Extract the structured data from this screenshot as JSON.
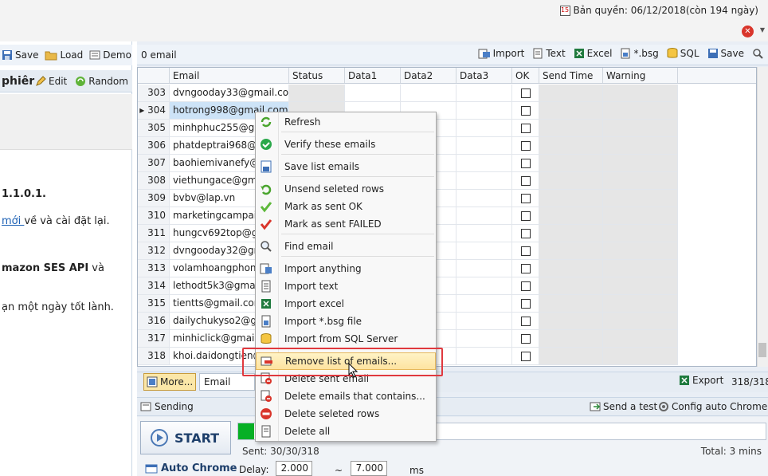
{
  "license": {
    "text": "Bản quyền: 06/12/2018(còn 194 ngày)",
    "cal_icon": "calendar-icon"
  },
  "left": {
    "toolbar": {
      "save": "Save",
      "load": "Load",
      "demo": "Demo"
    },
    "toolbar2": {
      "title": "phiêr",
      "edit": "Edit",
      "random": "Random"
    },
    "lines": {
      "version": "1.1.0.1.",
      "download_link": "mới ",
      "download_rest": "về và cài đặt lại.",
      "ses_bold": "mazon SES API",
      "ses_rest": " và",
      "greeting": "ạn một ngày tốt lành."
    }
  },
  "right": {
    "count_label": "0 email",
    "toolbar": {
      "import": "Import",
      "text": "Text",
      "excel": "Excel",
      "bsg": "*.bsg",
      "sql": "SQL",
      "save": "Save"
    },
    "columns": [
      "",
      "Email",
      "Status",
      "Data1",
      "Data2",
      "Data3",
      "OK",
      "Send Time",
      "Warning"
    ],
    "rows": [
      {
        "no": "303",
        "email": "dvngooday33@gmail.co"
      },
      {
        "no": "304",
        "email": "hotrong998@gmail.com"
      },
      {
        "no": "305",
        "email": "minhphuc255@gmail.c"
      },
      {
        "no": "306",
        "email": "phatdeptrai968@gmail"
      },
      {
        "no": "307",
        "email": "baohiemivanefy@gm"
      },
      {
        "no": "308",
        "email": "viethungace@gmail.c"
      },
      {
        "no": "309",
        "email": "bvbv@lap.vn"
      },
      {
        "no": "310",
        "email": "marketingcampaign"
      },
      {
        "no": "311",
        "email": "hungcv692top@gmail"
      },
      {
        "no": "312",
        "email": "dvngooday32@gmail."
      },
      {
        "no": "313",
        "email": "volamhoangphong@"
      },
      {
        "no": "314",
        "email": "lethodt5k3@gmail.co"
      },
      {
        "no": "315",
        "email": "tientts@gmail.com"
      },
      {
        "no": "316",
        "email": "dailychukyso2@gmai"
      },
      {
        "no": "317",
        "email": "minhiclick@gmail.co"
      },
      {
        "no": "318",
        "email": "khoi.daidongtien@g"
      }
    ],
    "bottom": {
      "more": "More...",
      "email_select": "Email",
      "export": "Export",
      "count": "318/318"
    },
    "send": {
      "label": "Sending",
      "send_test": "Send a test",
      "config_chrome": "Config auto Chrome",
      "start": "START",
      "progress": 1.0,
      "progress_color": "#06b025",
      "sent": "Sent: 30/30/318",
      "total": "Total: 3 mins",
      "auto_chrome": "Auto Chrome",
      "delay_label": "Delay:",
      "delay_min": "2.000",
      "tilde": "~",
      "delay_max": "7.000",
      "ms": "ms"
    }
  },
  "context_menu": {
    "items": [
      {
        "label": "Refresh",
        "icon": "refresh-icon"
      },
      {
        "label": "Verify these emails",
        "icon": "check-circle-icon"
      },
      {
        "label": "Save list emails",
        "icon": "save-list-icon"
      },
      {
        "label": "Unsend seleted rows",
        "icon": "undo-icon"
      },
      {
        "label": "Mark as sent OK",
        "icon": "green-check-icon"
      },
      {
        "label": "Mark as sent FAILED",
        "icon": "red-check-icon"
      },
      {
        "label": "Find email",
        "icon": "magnifier-icon"
      },
      {
        "label": "Import anything",
        "icon": "import-icon"
      },
      {
        "label": "Import text",
        "icon": "text-file-icon"
      },
      {
        "label": "Import excel",
        "icon": "excel-icon"
      },
      {
        "label": "Import *.bsg file",
        "icon": "bsg-file-icon"
      },
      {
        "label": "Import from SQL Server",
        "icon": "database-icon"
      },
      {
        "label": "Remove list of emails...",
        "icon": "remove-list-icon"
      },
      {
        "label": "Delete sent email",
        "icon": "delete-sent-icon"
      },
      {
        "label": "Delete emails that contains...",
        "icon": "delete-contains-icon"
      },
      {
        "label": "Delete seleted rows",
        "icon": "no-entry-icon"
      },
      {
        "label": "Delete all",
        "icon": "delete-all-icon"
      }
    ],
    "highlighted_index": 12,
    "highlight_border_color": "#e0393e"
  }
}
